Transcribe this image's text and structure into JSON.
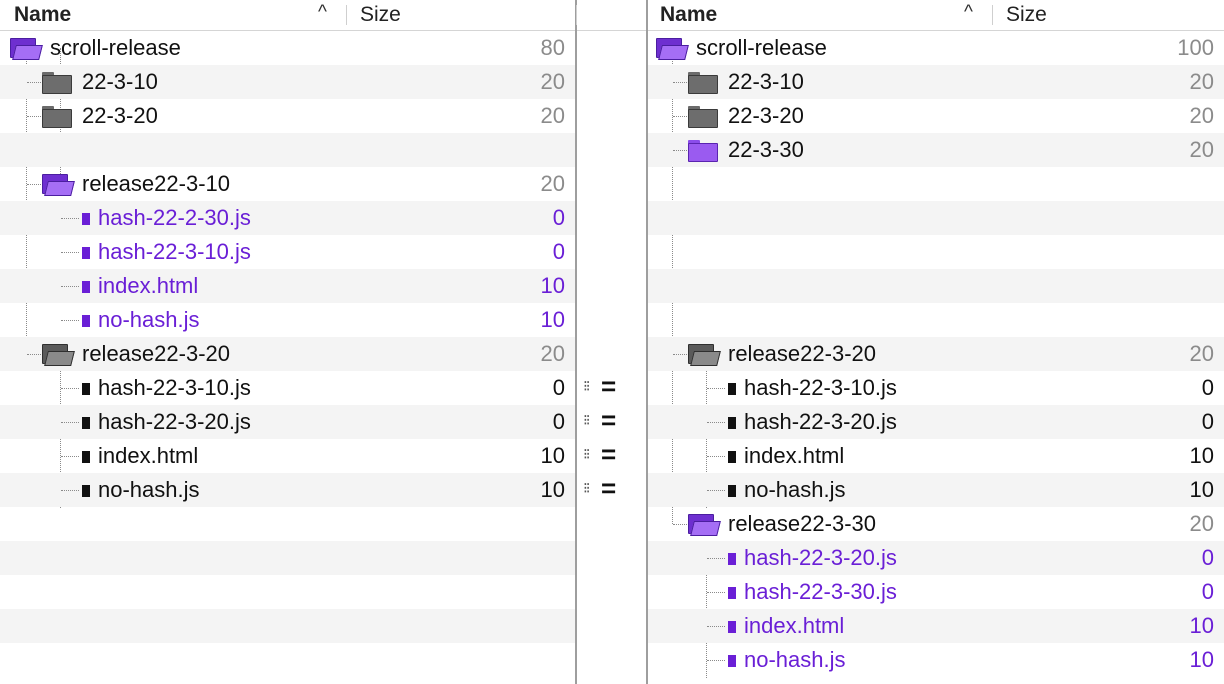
{
  "columns": {
    "name": "Name",
    "size": "Size",
    "sort_indicator": "^"
  },
  "left": {
    "rows": [
      {
        "label": "scroll-release",
        "size": "80"
      },
      {
        "label": "22-3-10",
        "size": "20"
      },
      {
        "label": "22-3-20",
        "size": "20"
      },
      {
        "label": "",
        "size": ""
      },
      {
        "label": "release22-3-10",
        "size": "20"
      },
      {
        "label": "hash-22-2-30.js",
        "size": "0"
      },
      {
        "label": "hash-22-3-10.js",
        "size": "0"
      },
      {
        "label": "index.html",
        "size": "10"
      },
      {
        "label": "no-hash.js",
        "size": "10"
      },
      {
        "label": "release22-3-20",
        "size": "20"
      },
      {
        "label": "hash-22-3-10.js",
        "size": "0"
      },
      {
        "label": "hash-22-3-20.js",
        "size": "0"
      },
      {
        "label": "index.html",
        "size": "10"
      },
      {
        "label": "no-hash.js",
        "size": "10"
      }
    ]
  },
  "right": {
    "rows": [
      {
        "label": "scroll-release",
        "size": "100"
      },
      {
        "label": "22-3-10",
        "size": "20"
      },
      {
        "label": "22-3-20",
        "size": "20"
      },
      {
        "label": "22-3-30",
        "size": "20"
      },
      {
        "label": "release22-3-20",
        "size": "20"
      },
      {
        "label": "hash-22-3-10.js",
        "size": "0"
      },
      {
        "label": "hash-22-3-20.js",
        "size": "0"
      },
      {
        "label": "index.html",
        "size": "10"
      },
      {
        "label": "no-hash.js",
        "size": "10"
      },
      {
        "label": "release22-3-30",
        "size": "20"
      },
      {
        "label": "hash-22-3-20.js",
        "size": "0"
      },
      {
        "label": "hash-22-3-30.js",
        "size": "0"
      },
      {
        "label": "index.html",
        "size": "10"
      },
      {
        "label": "no-hash.js",
        "size": "10"
      }
    ]
  },
  "compare": {
    "marker_glyph": "⁝⁝",
    "equal_sign": "="
  },
  "colors": {
    "diff_text": "#6a1fd6",
    "folder_purple": "#9a5bf0",
    "folder_gray": "#6d6d6d",
    "dim_size": "#8b8b8b"
  },
  "icons": {
    "folder_closed": "folder-closed-icon",
    "folder_open": "folder-open-icon",
    "file": "file-icon"
  }
}
